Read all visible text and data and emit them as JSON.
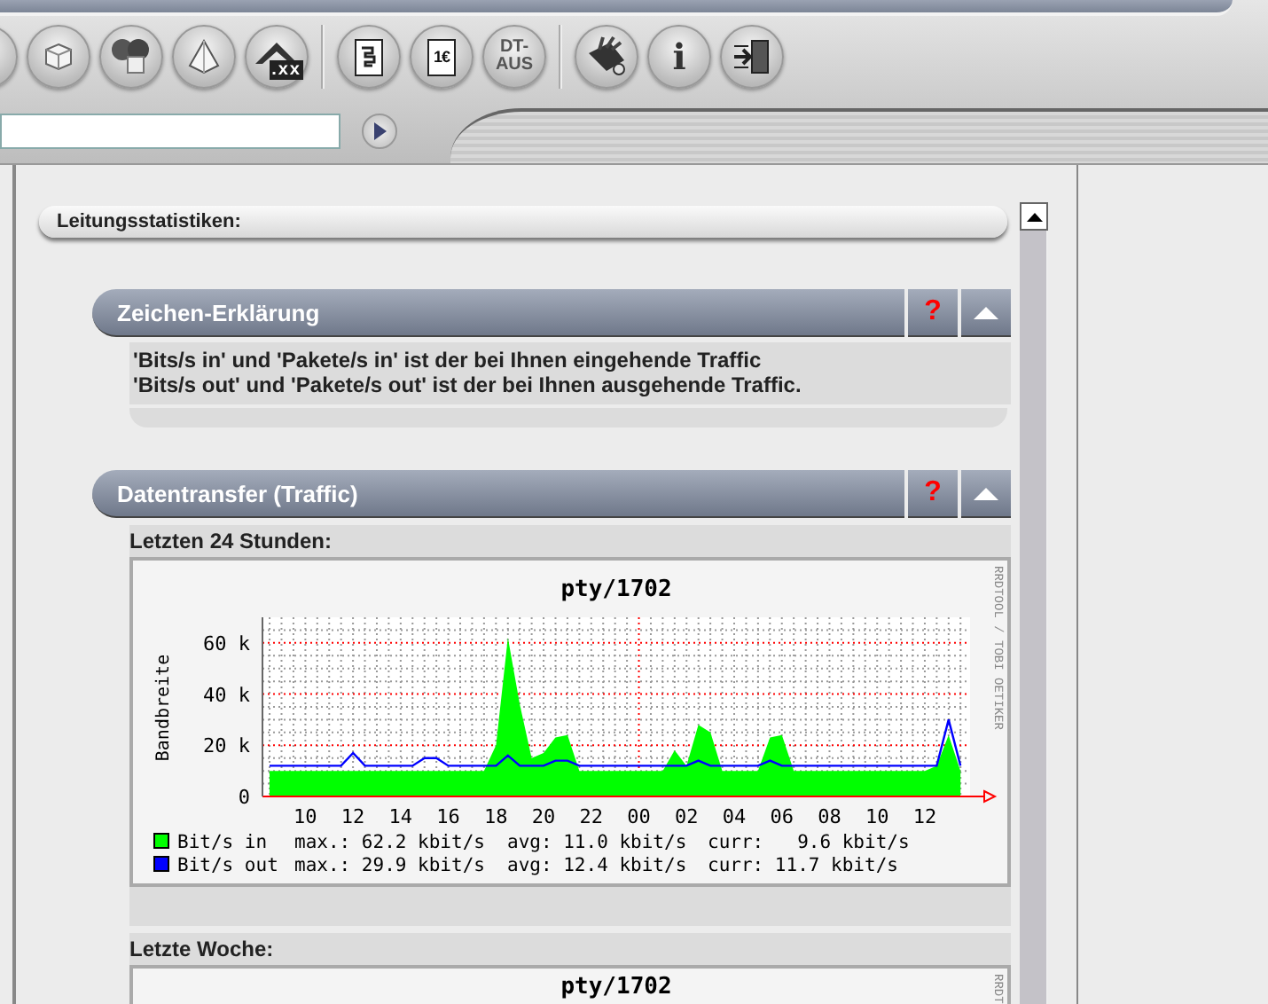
{
  "toolbar": {
    "groups": [
      [
        {
          "kind": "disc"
        },
        {
          "kind": "cube"
        },
        {
          "kind": "cubes"
        },
        {
          "kind": "pyramid"
        },
        {
          "kind": "tool",
          "label": ".xx"
        }
      ],
      [
        {
          "kind": "document"
        },
        {
          "kind": "document",
          "label": "1€"
        },
        {
          "kind": "text",
          "label": "DT-AUS"
        }
      ],
      [
        {
          "kind": "knife"
        },
        {
          "kind": "text",
          "label": "i"
        },
        {
          "kind": "exit"
        }
      ]
    ]
  },
  "section_bar": {
    "label": "Leitungsstatistiken:"
  },
  "panels": [
    {
      "title": "Zeichen-Erklärung",
      "help": "?",
      "lines": [
        "'Bits/s in' und 'Pakete/s in' ist der bei Ihnen eingehende Traffic",
        "'Bits/s out' und 'Pakete/s out' ist der bei Ihnen ausgehende Traffic."
      ]
    },
    {
      "title": "Datentransfer (Traffic)",
      "help": "?",
      "graphs": [
        {
          "label": "Letzten 24 Stunden:",
          "credit": "RRDTOOL / TOBI OETIKER",
          "chart_data": {
            "type": "area",
            "grid": true,
            "legend": "bottom",
            "title": "pty/1702",
            "ylabel": "Bandbreite",
            "xlim": [
              8.2,
              37.9
            ],
            "ylim": [
              0,
              70
            ],
            "xticks": [
              {
                "value": 10,
                "label": "10"
              },
              {
                "value": 12,
                "label": "12"
              },
              {
                "value": 14,
                "label": "14"
              },
              {
                "value": 16,
                "label": "16"
              },
              {
                "value": 18,
                "label": "18"
              },
              {
                "value": 20,
                "label": "20"
              },
              {
                "value": 22,
                "label": "22"
              },
              {
                "value": 24,
                "label": "00"
              },
              {
                "value": 26,
                "label": "02"
              },
              {
                "value": 28,
                "label": "04"
              },
              {
                "value": 30,
                "label": "06"
              },
              {
                "value": 32,
                "label": "08"
              },
              {
                "value": 34,
                "label": "10"
              },
              {
                "value": 36,
                "label": "12"
              }
            ],
            "yticks": [
              {
                "value": 0,
                "label": "0"
              },
              {
                "value": 20,
                "label": "20 k"
              },
              {
                "value": 40,
                "label": "40 k"
              },
              {
                "value": 60,
                "label": "60 k"
              }
            ],
            "x": [
              8.5,
              9,
              9.5,
              10,
              10.5,
              11,
              11.5,
              12,
              12.5,
              13,
              13.5,
              14,
              14.5,
              15,
              15.5,
              16,
              16.5,
              17,
              17.5,
              18,
              18.5,
              19,
              19.5,
              20,
              20.5,
              21,
              21.5,
              22,
              22.5,
              23,
              23.5,
              24,
              24.5,
              25,
              25.5,
              26,
              26.5,
              27,
              27.5,
              28,
              28.5,
              29,
              29.5,
              30,
              30.5,
              31,
              31.5,
              32,
              32.5,
              33,
              33.5,
              34,
              34.5,
              35,
              35.5,
              36,
              36.5,
              37,
              37.5
            ],
            "series": [
              {
                "name": "Bit/s in",
                "type": "area",
                "color": "#00ff00",
                "values": [
                  10,
                  10,
                  10,
                  10,
                  10,
                  10,
                  10,
                  10,
                  10,
                  10,
                  10,
                  10,
                  10,
                  10,
                  10,
                  10,
                  10,
                  10,
                  10,
                  20,
                  62,
                  36,
                  15,
                  17,
                  23,
                  24,
                  10,
                  10,
                  10,
                  10,
                  10,
                  10,
                  10,
                  10,
                  18,
                  12,
                  28,
                  25,
                  10,
                  10,
                  10,
                  10,
                  23,
                  24,
                  10,
                  10,
                  10,
                  10,
                  10,
                  10,
                  10,
                  10,
                  10,
                  10,
                  10,
                  10,
                  12,
                  24,
                  10
                ]
              },
              {
                "name": "Bit/s out",
                "type": "line",
                "color": "#0000ff",
                "values": [
                  12,
                  12,
                  12,
                  12,
                  12,
                  12,
                  12,
                  17,
                  12,
                  12,
                  12,
                  12,
                  12,
                  15,
                  15,
                  12,
                  12,
                  12,
                  12,
                  12,
                  16,
                  12,
                  12,
                  12,
                  14,
                  14,
                  12,
                  12,
                  12,
                  12,
                  12,
                  12,
                  12,
                  12,
                  12,
                  12,
                  14,
                  12,
                  12,
                  12,
                  12,
                  12,
                  14,
                  12,
                  12,
                  12,
                  12,
                  12,
                  12,
                  12,
                  12,
                  12,
                  12,
                  12,
                  12,
                  12,
                  12,
                  30,
                  12
                ]
              }
            ]
          },
          "legend": [
            {
              "max": "max.: 62.2 kbit/s",
              "avg": "avg: 11.0 kbit/s",
              "curr": "curr:   9.6 kbit/s"
            },
            {
              "max": "max.: 29.9 kbit/s",
              "avg": "avg: 12.4 kbit/s",
              "curr": "curr: 11.7 kbit/s"
            }
          ]
        },
        {
          "label": "Letzte Woche:",
          "title": "pty/1702",
          "credit": "RRDT"
        }
      ]
    }
  ]
}
